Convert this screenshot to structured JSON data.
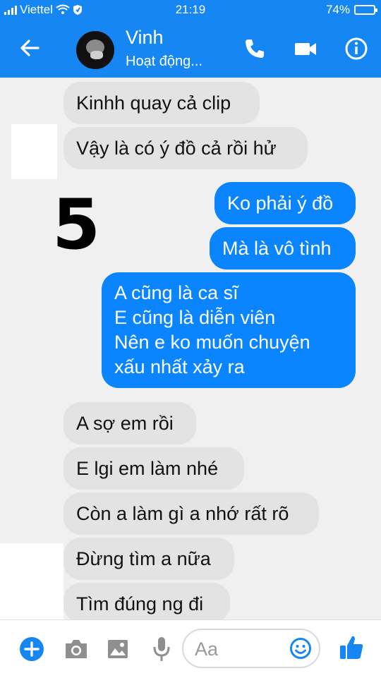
{
  "status_bar": {
    "carrier": "Viettel",
    "time": "21:19",
    "battery": "74%",
    "battery_level": 0.74
  },
  "header": {
    "contact_name": "Vinh",
    "presence": "Hoạt động..."
  },
  "overlay_number": "5",
  "messages": [
    {
      "side": "received",
      "text": "Kinhh quay cả clip"
    },
    {
      "side": "received",
      "text": "Vậy là có ý đồ cả rồi hử"
    },
    {
      "side": "sent",
      "text": "Ko phải ý đồ"
    },
    {
      "side": "sent",
      "text": "Mà là vô tình"
    },
    {
      "side": "sent",
      "text": "A cũng là ca sĩ\nE cũng là diễn viên\nNên e ko muốn chuyện\nxấu nhất xảy ra"
    },
    {
      "side": "received",
      "text": "A sợ em rồi"
    },
    {
      "side": "received",
      "text": "E lgi em làm nhé"
    },
    {
      "side": "received",
      "text": "Còn a làm gì a nhớ rất rõ"
    },
    {
      "side": "received",
      "text": "Đừng tìm a nữa"
    },
    {
      "side": "received",
      "text": "Tìm đúng ng đi"
    }
  ],
  "composer": {
    "placeholder": "Aa"
  },
  "colors": {
    "accent": "#1686f2",
    "sent_bubble": "#0b84ff",
    "received_bubble": "#e3e3e3"
  },
  "icons": {
    "header": [
      "back-arrow-icon",
      "phone-icon",
      "video-camera-icon",
      "info-icon"
    ],
    "bottom": [
      "plus-icon",
      "camera-icon",
      "image-icon",
      "microphone-icon",
      "emoji-icon",
      "like-thumb-icon"
    ]
  }
}
